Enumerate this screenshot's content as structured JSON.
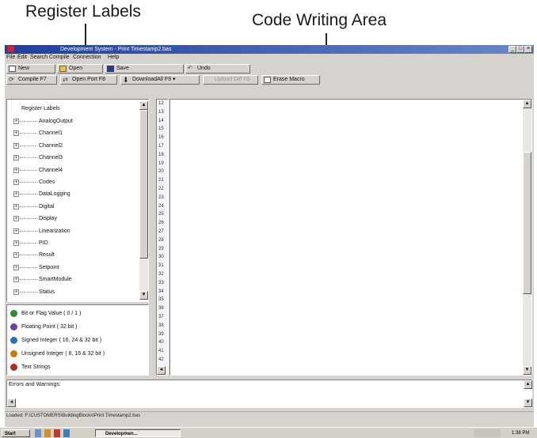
{
  "annotations": {
    "register_labels": "Register Labels",
    "code_writing_area": "Code Writing Area"
  },
  "window": {
    "title": "Development System - Print Timestamp2.bas",
    "min": "_",
    "max": "□",
    "close": "×"
  },
  "menu": [
    "File",
    "Edit",
    "Search",
    "Compile",
    "Connection",
    "Help"
  ],
  "toolbar1": {
    "new": "New",
    "open": "Open",
    "save": "Save",
    "undo": "Undo"
  },
  "toolbar2": {
    "compile": "Compile   F7",
    "open_port": "Open Port   F8",
    "download": "DownloadAll   F9 ▾",
    "upload": "Upload Diff    F5",
    "erase": "Erase Macro"
  },
  "tree": {
    "root": "Register Labels",
    "items": [
      "AnalogOutput",
      "Channel1",
      "Channel2",
      "Channel3",
      "Channel4",
      "Codes",
      "DataLogging",
      "Digital",
      "Display",
      "Linearization",
      "PID",
      "Result",
      "Setpoint",
      "SmartModule",
      "Status"
    ]
  },
  "legend": [
    {
      "label": "Bit or Flag Value ( 0 / 1 )",
      "color": "#2f8a2f"
    },
    {
      "label": "Floating Point ( 32 bit )",
      "color": "#6a3fb0"
    },
    {
      "label": "Signed Integer ( 16, 24 & 32 bit )",
      "color": "#2d6fb8"
    },
    {
      "label": "Unsigned Integer ( 8, 16 & 32 bit )",
      "color": "#c87a12"
    },
    {
      "label": "Text Strings",
      "color": "#b32a1e"
    }
  ],
  "line_numbers": [
    "12",
    "13",
    "14",
    "15",
    "16",
    "17",
    "18",
    "19",
    "20",
    "21",
    "22",
    "23",
    "24",
    "25",
    "26",
    "27",
    "28",
    "29",
    "30",
    "31",
    "32",
    "33",
    "34",
    "35",
    "36",
    "37",
    "38",
    "39",
    "40",
    "41",
    "42"
  ],
  "errors_label": "Errors and Warnings:",
  "status_path": "Loaded: F:\\CUSTOMERS\\BuildingBlocks\\Print Timestamp2.bas",
  "taskbar": {
    "start": "Start",
    "task": "Developmen...",
    "clock": "1:38 PM"
  }
}
